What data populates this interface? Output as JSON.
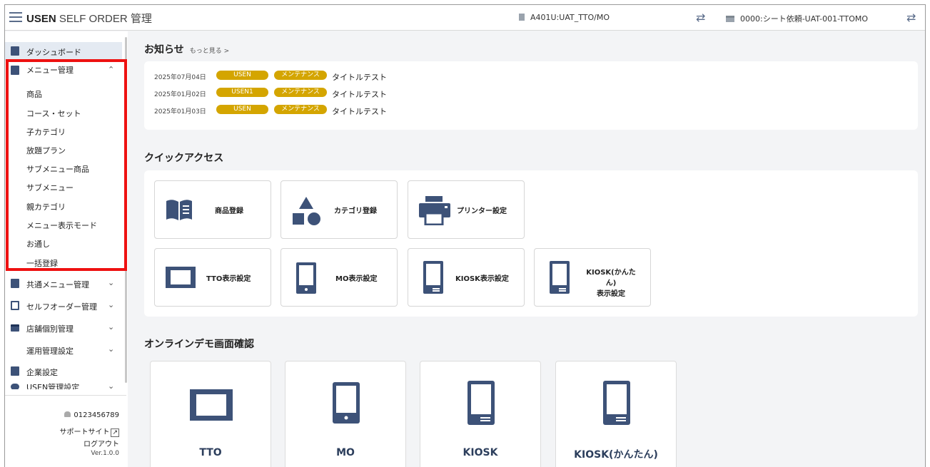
{
  "header": {
    "brand": "USEN",
    "title_rest": " SELF ORDER 管理",
    "store": "A401U:UAT_TTO/MO",
    "shop": "0000:シート依頼-UAT-001-TTOMO",
    "swap_glyph": "⇄"
  },
  "sidebar": {
    "dashboard": "ダッシュボード",
    "menu_mgmt": "メニュー管理",
    "menu_sub": [
      "商品",
      "コース・セット",
      "子カテゴリ",
      "放題プラン",
      "サブメニュー商品",
      "サブメニュー",
      "親カテゴリ",
      "メニュー表示モード",
      "お通し",
      "一括登録"
    ],
    "common_menu": "共通メニュー管理",
    "self_order": "セルフオーダー管理",
    "store_mgmt": "店舗個別管理",
    "ops_settings": "運用管理設定",
    "company": "企業設定",
    "usen_settings": "USEN管理設定",
    "chev_up": "⌃",
    "chev_down": "⌄",
    "user_id": "0123456789",
    "support": "サポートサイト",
    "support_icon": "↗",
    "logout": "ログアウト",
    "version": "Ver.1.0.0"
  },
  "notices": {
    "title": "お知らせ",
    "more": "もっと見る >",
    "items": [
      {
        "date": "2025年07月04日",
        "tag1": "USEN",
        "tag2": "メンテナンス",
        "title": "タイトルテスト"
      },
      {
        "date": "2025年01月02日",
        "tag1": "USEN1",
        "tag2": "メンテナンス",
        "title": "タイトルテスト"
      },
      {
        "date": "2025年01月03日",
        "tag1": "USEN",
        "tag2": "メンテナンス",
        "title": "タイトルテスト"
      }
    ]
  },
  "quick_access": {
    "title": "クイックアクセス",
    "items": [
      "商品登録",
      "カテゴリ登録",
      "プリンター設定",
      "TTO表示設定",
      "MO表示設定",
      "KIOSK表示設定",
      "KIOSK(かんたん)",
      "表示設定"
    ]
  },
  "demo": {
    "title": "オンラインデモ画面確認",
    "items": [
      "TTO",
      "MO",
      "KIOSK",
      "KIOSK(かんたん)"
    ]
  },
  "colors": {
    "brand_navy": "#3d5278",
    "badge_gold": "#d4a500",
    "highlight_red": "#ee1111"
  }
}
